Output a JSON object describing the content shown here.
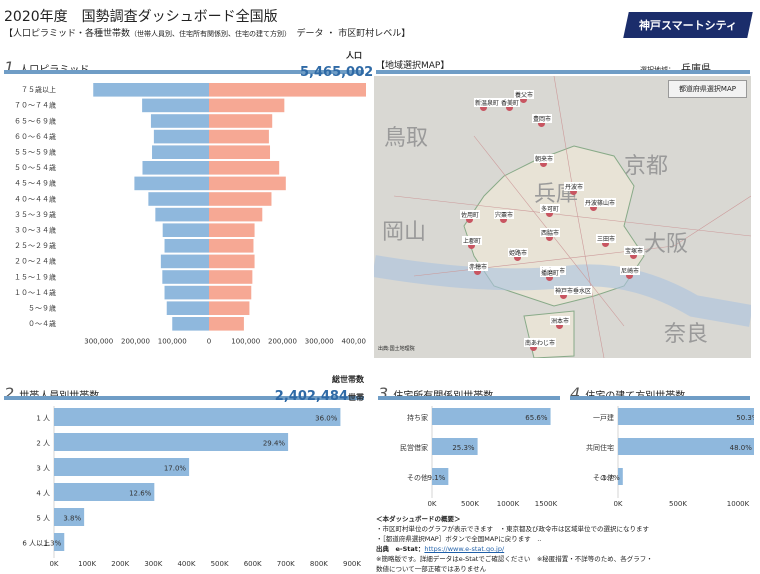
{
  "header": {
    "title": "2020年度　国勢調査ダッシュボード全国版",
    "subtitle": "【人口ピラミッド・各種世帯数",
    "subtitle_small": "（世帯人員別、住宅所有関係別、住宅の建て方別）",
    "subtitle_tail": "　データ ・ 市区町村レベル】",
    "logo": "神戸スマートシティ"
  },
  "pyramid": {
    "num": "1",
    "title": "人口ピラミッド",
    "total_label": "人口",
    "total_value": "5,465,002",
    "total_unit": "人"
  },
  "map": {
    "title": "【地域選択MAP】",
    "selected_label": "選択地域：",
    "selected_value": "兵庫県",
    "button": "都道府県選択MAP",
    "credit": "出典:国土地理院",
    "cities": [
      "新温泉町",
      "香美町",
      "豊岡市",
      "養父市",
      "朝来市",
      "丹波市",
      "丹波篠山市",
      "多可町",
      "佐用町",
      "宍粟市",
      "西脇市",
      "上郡町",
      "赤穂市",
      "姫路市",
      "加古川市",
      "三田市",
      "宝塚市",
      "尼崎市",
      "播磨町",
      "神戸市垂水区",
      "洲本市",
      "南あわじ市"
    ],
    "big_labels": [
      "鳥取",
      "兵庫",
      "京都",
      "岡山",
      "大阪",
      "奈良"
    ]
  },
  "hh_size": {
    "num": "2",
    "title": "世帯人員別世帯数",
    "total_label": "総世帯数",
    "total_value": "2,402,484",
    "total_unit": "世帯"
  },
  "tenure": {
    "num": "3",
    "title": "住宅所有関係別世帯数"
  },
  "building": {
    "num": "4",
    "title": "住宅の建て方別世帯数"
  },
  "notes": {
    "heading": "＜本ダッシュボードの概要＞",
    "line1": "・市区町村単位のグラフが表示できます　・東京都及び政令市は区域単位での選択になります",
    "line2": "・［都道府県選択MAP］ボタンで全国MAPに戻ります　..",
    "source_label": "出典　e-Stat：",
    "source_link": "https://www.e-stat.go.jp/",
    "line3": "※簡略版です。詳細データはe-Statでご確認ください　※秘匿措置・不詳等のため、各グラフ・",
    "line4": "数値について一部正確ではありません"
  },
  "chart_data": [
    {
      "type": "bar",
      "orientation": "horizontal-pyramid",
      "categories": [
        "７５歳以上",
        "７０～７４歳",
        "６５～６９歳",
        "６０～６４歳",
        "５５～５９歳",
        "５０～５４歳",
        "４５～４９歳",
        "４０～４４歳",
        "３５～３９歳",
        "３０～３４歳",
        "２５～２９歳",
        "２０～２４歳",
        "１５～１９歳",
        "１０～１４歳",
        "５～９歳",
        "０～４歳"
      ],
      "series": [
        {
          "values": [
            315000,
            182000,
            158000,
            150000,
            155000,
            181000,
            203000,
            165000,
            146000,
            126000,
            121000,
            131000,
            127000,
            121000,
            115000,
            100000
          ],
          "color": "#8fb8dd"
        },
        {
          "values": [
            483000,
            205000,
            172000,
            163000,
            166000,
            191000,
            209000,
            170000,
            145000,
            124000,
            121000,
            124000,
            118000,
            115000,
            110000,
            95000
          ],
          "color": "#f6a894"
        }
      ],
      "xlim": [
        -400000,
        400000
      ],
      "ticks": [
        "300,000",
        "200,000",
        "100,000",
        "0",
        "100,000",
        "200,000",
        "300,000",
        "400,000"
      ]
    },
    {
      "type": "bar",
      "orientation": "horizontal",
      "categories": [
        "1 人",
        "2 人",
        "3 人",
        "4 人",
        "5 人",
        "6 人以上"
      ],
      "values": [
        865000,
        707000,
        408000,
        303000,
        91000,
        31000
      ],
      "labels": [
        "36.0%",
        "29.4%",
        "17.0%",
        "12.6%",
        "3.8%",
        "1.3%"
      ],
      "xlim": [
        0,
        900000
      ],
      "ticks": [
        "0K",
        "100K",
        "200K",
        "300K",
        "400K",
        "500K",
        "600K",
        "700K",
        "800K",
        "900K"
      ]
    },
    {
      "type": "bar",
      "orientation": "horizontal",
      "categories": [
        "持ち家",
        "民営借家",
        "その他"
      ],
      "values": [
        1560000,
        600000,
        215000
      ],
      "labels": [
        "65.6%",
        "25.3%",
        "9.1%"
      ],
      "xlim": [
        0,
        1500000
      ],
      "ticks": [
        "0K",
        "500K",
        "1000K",
        "1500K"
      ]
    },
    {
      "type": "bar",
      "orientation": "horizontal",
      "categories": [
        "一戸建",
        "共同住宅",
        "その他"
      ],
      "values": [
        1196000,
        1141000,
        40000
      ],
      "labels": [
        "50.3%",
        "48.0%",
        "1.7%"
      ],
      "xlim": [
        0,
        1000000
      ],
      "ticks": [
        "0K",
        "500K",
        "1000K"
      ]
    }
  ]
}
